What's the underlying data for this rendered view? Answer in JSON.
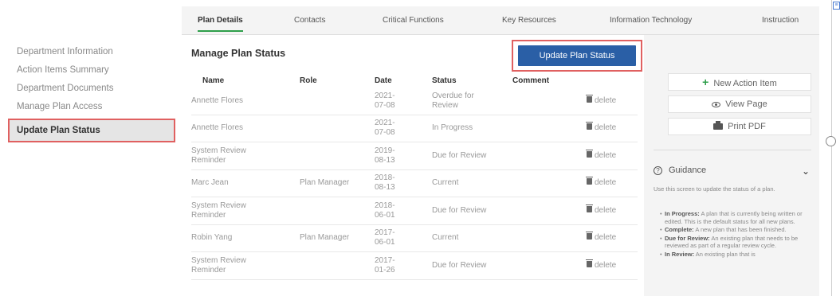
{
  "tabs": [
    {
      "label": "Plan Details",
      "active": true
    },
    {
      "label": "Contacts",
      "active": false
    },
    {
      "label": "Critical Functions",
      "active": false
    },
    {
      "label": "Key Resources",
      "active": false
    },
    {
      "label": "Information Technology",
      "active": false
    },
    {
      "label": "Instruction",
      "active": false
    }
  ],
  "sidebar": {
    "items": [
      {
        "label": "Department Information"
      },
      {
        "label": "Action Items Summary"
      },
      {
        "label": "Department Documents"
      },
      {
        "label": "Manage Plan Access"
      },
      {
        "label": "Update Plan Status",
        "active": true
      }
    ]
  },
  "main": {
    "title": "Manage Plan Status",
    "update_button": "Update Plan Status",
    "columns": [
      "Name",
      "Role",
      "Date",
      "Status",
      "Comment"
    ],
    "delete_label": "delete",
    "rows": [
      {
        "name": "Annette Flores",
        "role": "",
        "date": "2021-\n07-08",
        "status": "Overdue for Review"
      },
      {
        "name": "Annette Flores",
        "role": "",
        "date": "2021-\n07-08",
        "status": "In Progress"
      },
      {
        "name": "System Review Reminder",
        "role": "",
        "date": "2019-\n08-13",
        "status": "Due for Review"
      },
      {
        "name": "Marc Jean",
        "role": "Plan Manager",
        "date": "2018-\n08-13",
        "status": "Current"
      },
      {
        "name": "System Review Reminder",
        "role": "",
        "date": "2018-\n06-01",
        "status": "Due for Review"
      },
      {
        "name": "Robin Yang",
        "role": "Plan Manager",
        "date": "2017-\n06-01",
        "status": "Current"
      },
      {
        "name": "System Review Reminder",
        "role": "",
        "date": "2017-\n01-26",
        "status": "Due for Review"
      }
    ]
  },
  "panel": {
    "new_action": "New Action Item",
    "view_page": "View Page",
    "print_pdf": "Print PDF",
    "guidance_title": "Guidance",
    "guidance_intro": "Use this screen to update the status of a plan.",
    "guidance_items": [
      {
        "term": "In Progress:",
        "text": "A plan that is currently being written or edited. This is the default status for all new plans."
      },
      {
        "term": "Complete:",
        "text": "A new plan that has been finished."
      },
      {
        "term": "Due for Review:",
        "text": "An existing plan that needs to be reviewed as part of a regular review cycle."
      },
      {
        "term": "In Review:",
        "text": "An existing plan that is"
      }
    ]
  },
  "colors": {
    "accent": "#2a5fa6",
    "tab_underline": "#2e9e4a",
    "highlight_border": "#e06060"
  }
}
